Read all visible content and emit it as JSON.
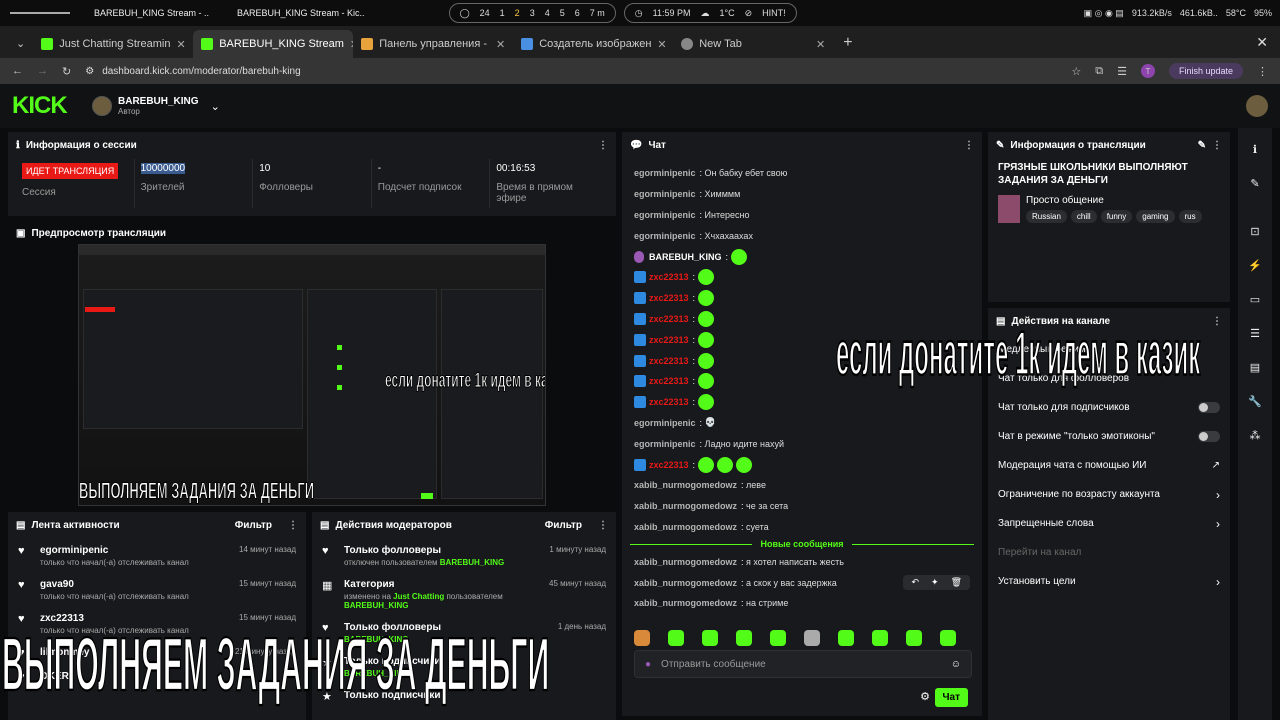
{
  "taskbar": {
    "window1": "BAREBUH_KING Stream - ..",
    "window2": "BAREBUH_KING Stream - Kic..",
    "ws_count": "24",
    "workspaces": [
      "1",
      "2",
      "3",
      "4",
      "5",
      "6",
      "7 m"
    ],
    "time": "11:59 PM",
    "temp": "1°C",
    "hint": "HINT!",
    "net": "913.2kB/s",
    "net2": "461.6kB..",
    "cpu_temp": "58°C",
    "battery": "95%"
  },
  "browser": {
    "tabs": [
      {
        "label": "Just Chatting Streamin",
        "icon_color": "#53fc18"
      },
      {
        "label": "BAREBUH_KING Stream",
        "icon_color": "#53fc18"
      },
      {
        "label": "Панель управления -",
        "icon_color": "#e8a33d"
      },
      {
        "label": "Создатель изображен",
        "icon_color": "#4a90e2"
      },
      {
        "label": "New Tab",
        "icon_color": "#888888"
      }
    ],
    "url": "dashboard.kick.com/moderator/barebuh-king",
    "finish_update": "Finish update",
    "profile_letter": "T"
  },
  "header": {
    "logo": "KICK",
    "channel_name": "BAREBUH_KING",
    "role": "Автор"
  },
  "session": {
    "title": "Информация о сессии",
    "live_label": "ИДЕТ ТРАНСЛЯЦИЯ",
    "live_sub": "Сессия",
    "viewers_value": "10000000",
    "viewers_label": "Зрителей",
    "followers_value": "10",
    "followers_label": "Фолловеры",
    "subs_value": "-",
    "subs_label": "Подсчет подписок",
    "uptime_value": "00:16:53",
    "uptime_label": "Время в прямом эфире"
  },
  "preview": {
    "title": "Предпросмотр трансляции",
    "caption_top": "если донатите 1к идем в казик",
    "caption_bottom": "ВЫПОЛНЯЕМ ЗАДАНИЯ ЗА ДЕНЬГИ"
  },
  "activity": {
    "title": "Лента активности",
    "filter": "Фильтр",
    "items": [
      {
        "title": "egorminipenic",
        "sub": "только что начал(-а) отслеживать канал",
        "time": "14 минут назад"
      },
      {
        "title": "gava90",
        "sub": "только что начал(-а) отслеживать канал",
        "time": "15 минут назад"
      },
      {
        "title": "zxc22313",
        "sub": "только что начал(-а) отслеживать канал",
        "time": "15 минут назад"
      },
      {
        "title": "lilmonmey",
        "sub": "",
        "time": "21 минуту назад"
      },
      {
        "title": "OKER",
        "sub": "",
        "time": ""
      }
    ]
  },
  "modactions": {
    "title": "Действия модераторов",
    "filter": "Фильтр",
    "items": [
      {
        "title": "Только фолловеры",
        "sub1": "отключен пользователем ",
        "sub_green": "BAREBUH_KING",
        "sub2": "",
        "sub_green2": "",
        "time": "1 минуту назад"
      },
      {
        "title": "Категория",
        "sub1": "изменено на ",
        "sub_green": "Just Chatting",
        "sub2": " пользователем ",
        "sub_green2": "BAREBUH_KING",
        "time": "45 минут назад"
      },
      {
        "title": "Только фолловеры",
        "sub1": "",
        "sub_green": "BAREBUH_KING",
        "sub2": "",
        "sub_green2": "",
        "time": "1 день назад"
      },
      {
        "title": "Только подписчики",
        "sub1": "",
        "sub_green": "BAREBUH_KING",
        "sub2": "",
        "sub_green2": "",
        "time": ""
      },
      {
        "title": "Только подписчики",
        "sub1": "",
        "sub_green": "",
        "sub2": "",
        "sub_green2": "",
        "time": ""
      }
    ]
  },
  "chat": {
    "title": "Чат",
    "messages": [
      {
        "user": "egorminipenic",
        "msg": "Он бабку ебет свою",
        "type": "normal"
      },
      {
        "user": "egorminipenic",
        "msg": "Химммм",
        "type": "normal"
      },
      {
        "user": "egorminipenic",
        "msg": "Интересно",
        "type": "normal"
      },
      {
        "user": "egorminipenic",
        "msg": "Хчхахаахах",
        "type": "normal"
      },
      {
        "user": "BAREBUH_KING",
        "msg": "",
        "type": "host",
        "emotes": 1
      },
      {
        "user": "zxc22313",
        "msg": "",
        "type": "red",
        "emotes": 1
      },
      {
        "user": "zxc22313",
        "msg": "",
        "type": "red",
        "emotes": 1
      },
      {
        "user": "zxc22313",
        "msg": "",
        "type": "red",
        "emotes": 1
      },
      {
        "user": "zxc22313",
        "msg": "",
        "type": "red",
        "emotes": 1
      },
      {
        "user": "zxc22313",
        "msg": "",
        "type": "red",
        "emotes": 1
      },
      {
        "user": "zxc22313",
        "msg": "",
        "type": "red",
        "emotes": 1
      },
      {
        "user": "zxc22313",
        "msg": "",
        "type": "red",
        "emotes": 1
      },
      {
        "user": "egorminipenic",
        "msg": "💀",
        "type": "normal"
      },
      {
        "user": "egorminipenic",
        "msg": "Ладно идите нахуй",
        "type": "normal"
      },
      {
        "user": "zxc22313",
        "msg": "",
        "type": "red",
        "emotes": 3
      },
      {
        "user": "xabib_nurmogomedowz",
        "msg": "леве",
        "type": "normal"
      },
      {
        "user": "xabib_nurmogomedowz",
        "msg": "че за сета",
        "type": "normal"
      },
      {
        "user": "xabib_nurmogomedowz",
        "msg": "суета",
        "type": "normal"
      }
    ],
    "new_messages": "Новые сообщения",
    "new_msgs": [
      {
        "user": "xabib_nurmogomedowz",
        "msg": "я хотел написать жесть"
      },
      {
        "user": "xabib_nurmogomedowz",
        "msg": "а скок у вас задержка"
      },
      {
        "user": "xabib_nurmogomedowz",
        "msg": "на стриме"
      }
    ],
    "input_placeholder": "Отправить сообщение",
    "send_label": "Чат"
  },
  "streaminfo": {
    "title": "Информация о трансляции",
    "stream_title": "ГРЯЗНЫЕ ШКОЛЬНИКИ ВЫПОЛНЯЮТ ЗАДАНИЯ ЗА ДЕНЬГИ",
    "category": "Просто общение",
    "tags": [
      "Russian",
      "chill",
      "funny",
      "gaming",
      "rus"
    ]
  },
  "channel_actions": {
    "title": "Действия на канале",
    "rows": [
      {
        "label": "Медленный режим",
        "control": "none"
      },
      {
        "label": "Чат только для фолловеров",
        "control": "none"
      },
      {
        "label": "Чат только для подписчиков",
        "control": "toggle"
      },
      {
        "label": "Чат в режиме \"только эмотиконы\"",
        "control": "toggle"
      },
      {
        "label": "Модерация чата с помощью ИИ",
        "control": "ext"
      },
      {
        "label": "Ограничение по возрасту аккаунта",
        "control": "chev"
      },
      {
        "label": "Запрещенные слова",
        "control": "chev"
      },
      {
        "label": "Перейти на канал",
        "control": "disabled"
      },
      {
        "label": "Установить цели",
        "control": "chev"
      }
    ]
  },
  "overlays": {
    "right_text": "если донатите 1к идем в казик",
    "bottom_text": "ВЫПОЛНЯЕМ ЗАДАНИЯ ЗА ДЕНЬГИ"
  },
  "colors": {
    "kick_green": "#53fc18",
    "live_red": "#e91916",
    "panel": "#18191c",
    "mod_blue": "#2d8ae0"
  }
}
